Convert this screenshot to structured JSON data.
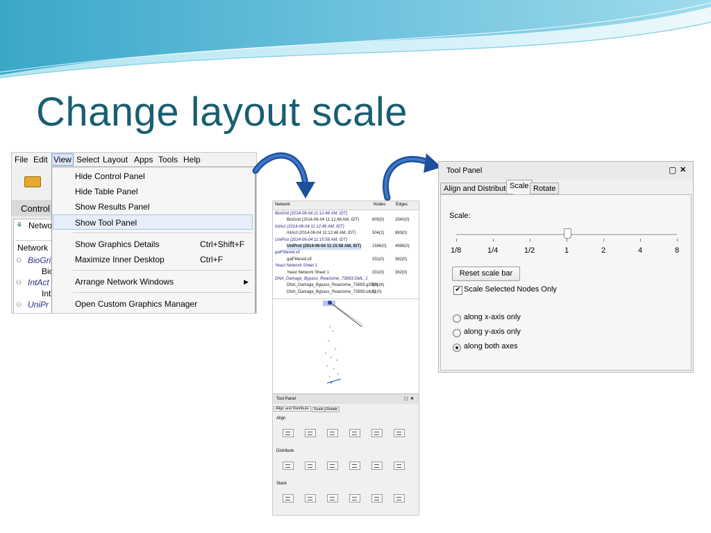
{
  "slide": {
    "title": "Change layout scale"
  },
  "cytoscape": {
    "menubar": [
      "File",
      "Edit",
      "View",
      "Select",
      "Layout",
      "Apps",
      "Tools",
      "Help"
    ],
    "active_menu": "View",
    "control_tab": "Control",
    "panel_tab": "Netwo",
    "panel_header": "Network",
    "tree": [
      "BioGri",
      "Bio",
      "IntAct",
      "Int",
      "UniPr"
    ],
    "view_menu": [
      {
        "label": "Hide Control Panel",
        "accel": ""
      },
      {
        "label": "Hide Table Panel",
        "accel": ""
      },
      {
        "label": "Show Results Panel",
        "accel": ""
      },
      {
        "label": "Show Tool Panel",
        "accel": ""
      },
      {
        "label": "Show Graphics Details",
        "accel": "Ctrl+Shift+F"
      },
      {
        "label": "Maximize Inner Desktop",
        "accel": "Ctrl+F"
      },
      {
        "label": "Arrange Network Windows",
        "accel": ""
      },
      {
        "label": "Open Custom Graphics Manager",
        "accel": ""
      }
    ]
  },
  "network_table": {
    "columns": [
      "Network",
      "Nodes",
      "Edges"
    ],
    "rows": [
      {
        "name": "BioGrid (2014-06-04 11:12:48 AM, IDT)",
        "nodes": "",
        "edges": "",
        "group": true
      },
      {
        "name": "BioGrid (2014-06-04 11:12:48 AM, IDT)",
        "nodes": "805(0)",
        "edges": "2540(0)",
        "group": false
      },
      {
        "name": "IntAct (2014-06-04 11:12:49 AM, IDT)",
        "nodes": "",
        "edges": "",
        "group": true
      },
      {
        "name": "IntAct (2014-06-04 11:12:48 AM, IDT)",
        "nodes": "504(2)",
        "edges": "883(0)",
        "group": false
      },
      {
        "name": "UniProt (2014-06-04 11:15:58 AM, IDT)",
        "nodes": "",
        "edges": "",
        "group": true
      },
      {
        "name": "UniProt (2014-06-04 11:15:58 AM, IDT)",
        "nodes": "1596(0)",
        "edges": "4996(0)",
        "group": false,
        "selected": true
      },
      {
        "name": "galFiltered.sif",
        "nodes": "",
        "edges": "",
        "group": true
      },
      {
        "name": "galFiltered.sif",
        "nodes": "331(0)",
        "edges": "362(0)",
        "group": false
      },
      {
        "name": "Yeast Network Sheet 1",
        "nodes": "",
        "edges": "",
        "group": true
      },
      {
        "name": "Yeast Network Sheet 1",
        "nodes": "331(0)",
        "edges": "362(0)",
        "group": false
      },
      {
        "name": "DNA_Damage_Bypass_Reactome_73893.GML_1",
        "nodes": "",
        "edges": "",
        "group": true
      },
      {
        "name": "DNA_Damage_Bypass_Reactome_73893.g35(8)",
        "nodes": "50(16)",
        "edges": "",
        "group": false
      },
      {
        "name": "DNA_Damage_Bypass_Reactome_73893.o8(0)",
        "nodes": "11(0)",
        "edges": "",
        "group": false
      }
    ]
  },
  "tool_panel_small": {
    "title": "Tool Panel",
    "tabs": [
      "Align and Distribute",
      "Scale",
      "Rotate"
    ],
    "sections": [
      "Align",
      "Distribute",
      "Stack"
    ]
  },
  "tool_panel": {
    "title": "Tool Panel",
    "tabs": [
      "Align and Distribute",
      "Scale",
      "Rotate"
    ],
    "selected_tab": "Scale",
    "scale_label": "Scale:",
    "ticks": [
      "1/8",
      "1/4",
      "1/2",
      "1",
      "2",
      "4",
      "8"
    ],
    "slider_value": "1",
    "reset_button": "Reset scale bar",
    "checkbox_label": "Scale Selected Nodes Only",
    "checkbox_checked": true,
    "radios": [
      {
        "label": "along x-axis only",
        "checked": false
      },
      {
        "label": "along y-axis only",
        "checked": false
      },
      {
        "label": "along both axes",
        "checked": true
      }
    ]
  },
  "colors": {
    "title": "#1a5e72",
    "arrow": "#1f4f9a",
    "header_wave": "#5ac6e0"
  }
}
